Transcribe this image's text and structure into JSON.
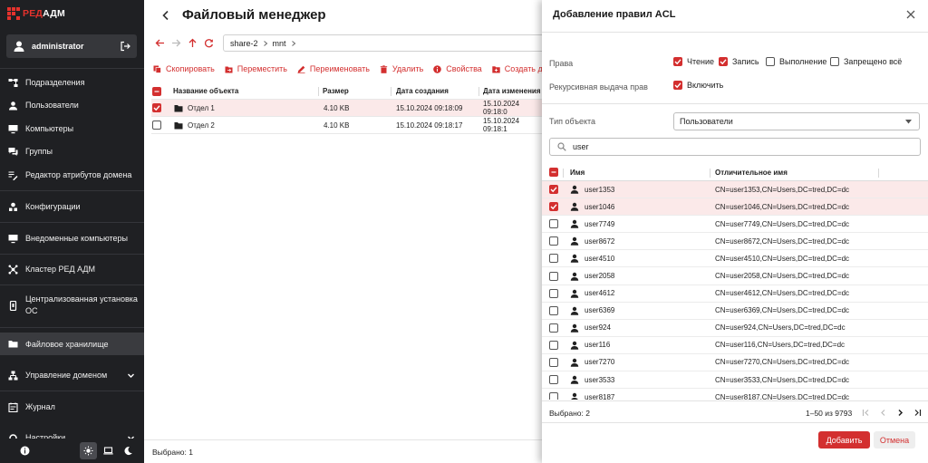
{
  "app": {
    "logo_text_a": "РЕД",
    "logo_text_b": "АДМ",
    "username": "administrator"
  },
  "sidebar": {
    "items": [
      {
        "label": "Подразделения",
        "icon": "org-structure-icon"
      },
      {
        "label": "Пользователи",
        "icon": "user-icon"
      },
      {
        "label": "Компьютеры",
        "icon": "monitor-icon"
      },
      {
        "label": "Группы",
        "icon": "group-chat-icon"
      },
      {
        "label": "Редактор атрибутов домена",
        "icon": "list-edit-icon"
      },
      {
        "label": "Конфигурации",
        "icon": "config-icon"
      },
      {
        "label": "Внедоменные компьютеры",
        "icon": "monitor-icon"
      },
      {
        "label": "Кластер РЕД АДМ",
        "icon": "cluster-icon"
      },
      {
        "label": "Централизованная установка",
        "label2": "ОС",
        "icon": "install-device-icon"
      },
      {
        "label": "Файловое хранилище",
        "icon": "folder-icon",
        "active": true
      },
      {
        "label": "Управление доменом",
        "icon": "domain-tree-icon",
        "expandable": true
      },
      {
        "label": "Журнал",
        "icon": "journal-icon"
      },
      {
        "label": "Настройки",
        "icon": "settings-icon",
        "expandable": true
      }
    ]
  },
  "main": {
    "title": "Файловый менеджер",
    "path": [
      "share-2",
      "mnt"
    ],
    "toolbar": [
      {
        "label": "Скопировать",
        "icon": "copy-icon"
      },
      {
        "label": "Переместить",
        "icon": "move-icon"
      },
      {
        "label": "Переименовать",
        "icon": "rename-icon"
      },
      {
        "label": "Удалить",
        "icon": "delete-icon"
      },
      {
        "label": "Свойства",
        "icon": "info-icon"
      },
      {
        "label": "Создать ди",
        "icon": "new-folder-icon"
      }
    ],
    "columns": [
      "Название объекта",
      "Размер",
      "Дата создания",
      "Дата изменения"
    ],
    "rows": [
      {
        "name": "Отдел 1",
        "size": "4.10 KB",
        "created": "15.10.2024 09:18:09",
        "modified": "15.10.2024 09:18:0",
        "selected": true
      },
      {
        "name": "Отдел 2",
        "size": "4.10 KB",
        "created": "15.10.2024 09:18:17",
        "modified": "15.10.2024 09:18:1",
        "selected": false
      }
    ],
    "status": "Выбрано: 1"
  },
  "dialog": {
    "title": "Добавление правил ACL",
    "rights_label": "Права",
    "rights": [
      {
        "label": "Чтение",
        "checked": true
      },
      {
        "label": "Запись",
        "checked": true
      },
      {
        "label": "Выполнение",
        "checked": false
      },
      {
        "label": "Запрещено всё",
        "checked": false
      }
    ],
    "recursive_label": "Рекурсивная выдача прав",
    "recursive_option": "Включить",
    "recursive_checked": true,
    "object_type_label": "Тип объекта",
    "object_type_value": "Пользователи",
    "search_value": "user",
    "columns": [
      "Имя",
      "Отличительное имя"
    ],
    "users": [
      {
        "name": "user1353",
        "dn": "CN=user1353,CN=Users,DC=tred,DC=dc",
        "checked": true
      },
      {
        "name": "user1046",
        "dn": "CN=user1046,CN=Users,DC=tred,DC=dc",
        "checked": true
      },
      {
        "name": "user7749",
        "dn": "CN=user7749,CN=Users,DC=tred,DC=dc",
        "checked": false
      },
      {
        "name": "user8672",
        "dn": "CN=user8672,CN=Users,DC=tred,DC=dc",
        "checked": false
      },
      {
        "name": "user4510",
        "dn": "CN=user4510,CN=Users,DC=tred,DC=dc",
        "checked": false
      },
      {
        "name": "user2058",
        "dn": "CN=user2058,CN=Users,DC=tred,DC=dc",
        "checked": false
      },
      {
        "name": "user4612",
        "dn": "CN=user4612,CN=Users,DC=tred,DC=dc",
        "checked": false
      },
      {
        "name": "user6369",
        "dn": "CN=user6369,CN=Users,DC=tred,DC=dc",
        "checked": false
      },
      {
        "name": "user924",
        "dn": "CN=user924,CN=Users,DC=tred,DC=dc",
        "checked": false
      },
      {
        "name": "user116",
        "dn": "CN=user116,CN=Users,DC=tred,DC=dc",
        "checked": false
      },
      {
        "name": "user7270",
        "dn": "CN=user7270,CN=Users,DC=tred,DC=dc",
        "checked": false
      },
      {
        "name": "user3533",
        "dn": "CN=user3533,CN=Users,DC=tred,DC=dc",
        "checked": false
      },
      {
        "name": "user8187",
        "dn": "CN=user8187,CN=Users,DC=tred,DC=dc",
        "checked": false
      }
    ],
    "selected_count": "Выбрано: 2",
    "range": "1–50 из 9793",
    "add_button": "Добавить",
    "cancel_button": "Отмена"
  },
  "colors": {
    "accent": "#d32f2f",
    "sidebar_bg": "#1f2023",
    "selected_row": "#fbe9e9"
  }
}
